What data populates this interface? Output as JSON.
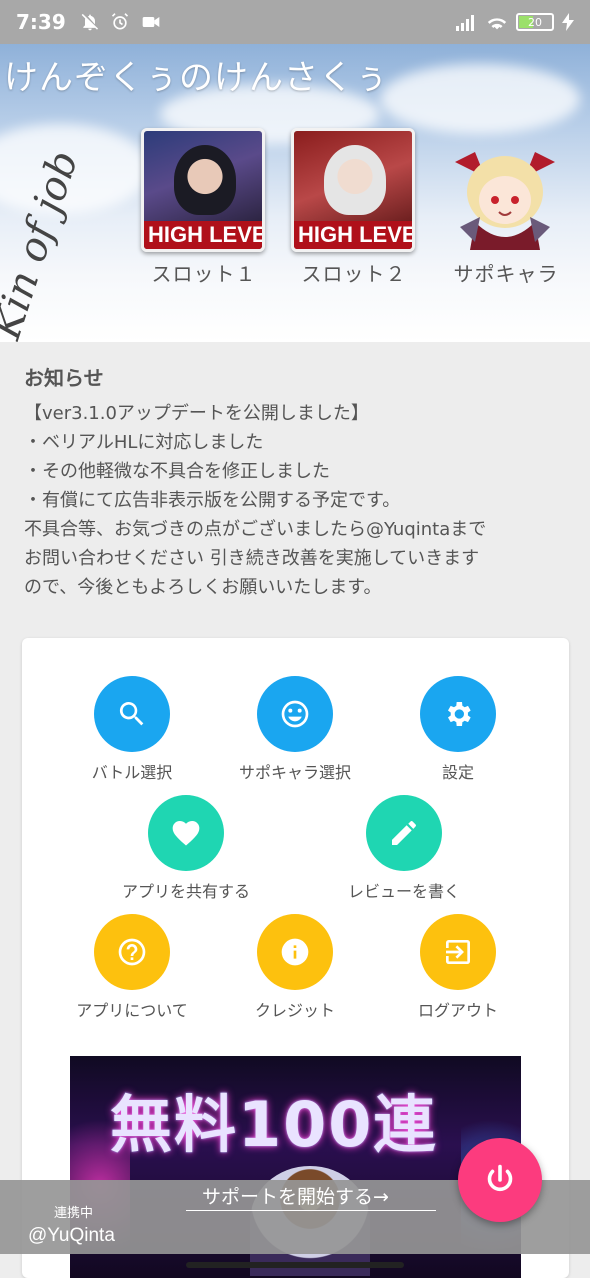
{
  "status_bar": {
    "time": "7:39",
    "battery": "20",
    "left_icons": [
      "mute-icon",
      "alarm-icon",
      "video-icon"
    ],
    "right_icons": [
      "signal-icon",
      "wifi-icon",
      "battery-icon",
      "charging-icon"
    ]
  },
  "header": {
    "app_title": "けんぞくぅのけんさくぅ",
    "logo_text": "Kin of job",
    "slots": [
      {
        "label": "スロット１",
        "banner": "HIGH LEVE"
      },
      {
        "label": "スロット２",
        "banner": "HIGH LEVE"
      }
    ],
    "support_char_label": "サポキャラ"
  },
  "notice": {
    "title": "お知らせ",
    "lines": [
      "【ver3.1.0アップデートを公開しました】",
      "・ベリアルHLに対応しました",
      "・その他軽微な不具合を修正しました",
      "・有償にて広告非表示版を公開する予定です。",
      " 不具合等、お気づきの点がございましたら@Yuqintaまで",
      "お問い合わせください 引き続き改善を実施していきます",
      "ので、今後ともよろしくお願いいたします。"
    ]
  },
  "menu": {
    "items": [
      {
        "label": "バトル選択",
        "icon": "search-icon",
        "color": "#1aa6f0"
      },
      {
        "label": "サポキャラ選択",
        "icon": "smiley-icon",
        "color": "#1aa6f0"
      },
      {
        "label": "設定",
        "icon": "gear-icon",
        "color": "#1aa6f0"
      },
      {
        "label": "アプリを共有する",
        "icon": "heart-icon",
        "color": "#1fd6b2"
      },
      {
        "label": "レビューを書く",
        "icon": "pencil-icon",
        "color": "#1fd6b2"
      },
      {
        "label": "アプリについて",
        "icon": "help-icon",
        "color": "#fdc10e"
      },
      {
        "label": "クレジット",
        "icon": "info-icon",
        "color": "#fdc10e"
      },
      {
        "label": "ログアウト",
        "icon": "logout-icon",
        "color": "#fdc10e"
      }
    ]
  },
  "ad": {
    "text": "無料100連"
  },
  "bottom_bar": {
    "working_label": "連携中",
    "user_handle": "@YuQinta",
    "start_support": "サポートを開始する→",
    "fab_icon": "power-icon",
    "fab_color": "#fc3b7e"
  }
}
